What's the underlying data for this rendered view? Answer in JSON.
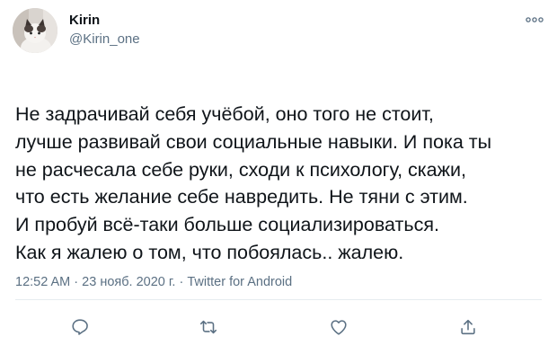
{
  "author": {
    "display_name": "Kirin",
    "handle": "@Kirin_one"
  },
  "tweet": {
    "lines": [
      "Не задрачивай себя учёбой, оно того не стоит,",
      "лучше развивай свои социальные навыки. И пока ты",
      "не расчесала себе руки, сходи к психологу, скажи,",
      "что есть желание себе навредить. Не тяни с этим.",
      "И пробуй всё-таки больше социализироваться.",
      "Как я жалею о том, что побоялась.. жалею."
    ],
    "time": "12:52 AM",
    "date": "23 нояб. 2020 г.",
    "source": "Twitter for Android",
    "separator": "·"
  },
  "icons": {
    "more": "more-icon",
    "reply": "reply-icon",
    "retweet": "retweet-icon",
    "like": "like-icon",
    "share": "share-icon"
  },
  "colors": {
    "text": "#0f1419",
    "secondary": "#5b7083",
    "divider": "#e6ecf0"
  }
}
